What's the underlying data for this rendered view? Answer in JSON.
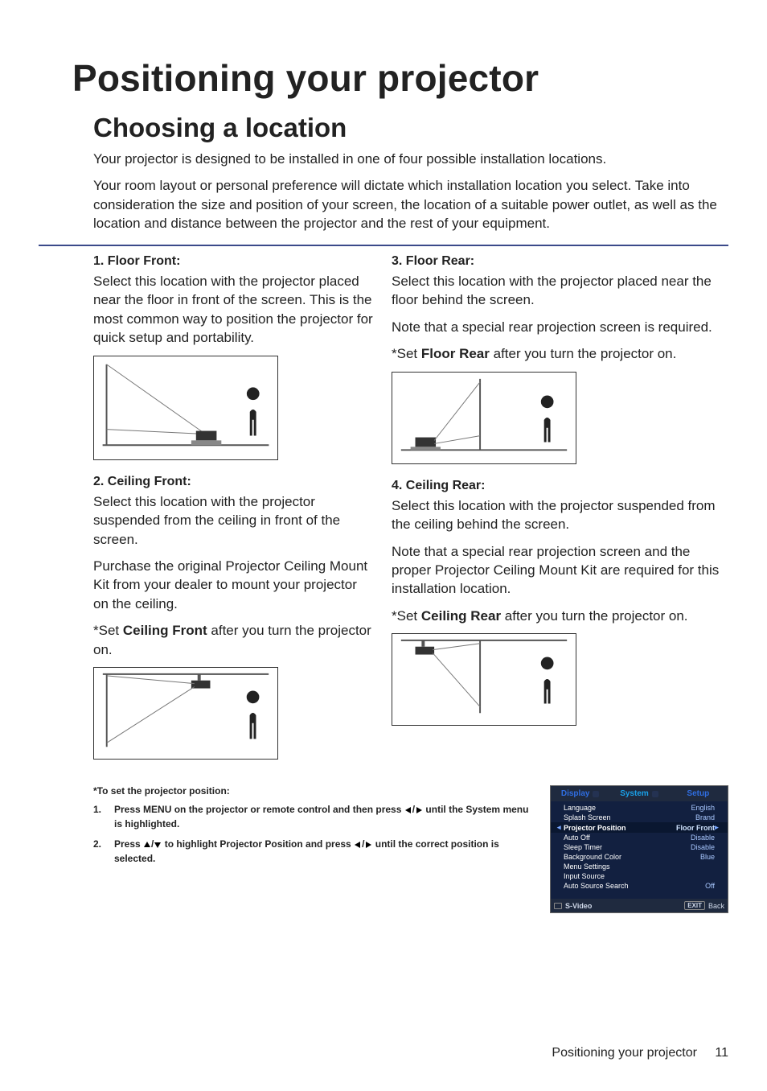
{
  "title": "Positioning your projector",
  "section": "Choosing a location",
  "intro": [
    "Your projector is designed to be installed in one of four possible installation locations.",
    "Your room layout or personal preference will dictate which installation location you select. Take into consideration the size and position of your screen, the location of a suitable power outlet, as well as the location and distance between the projector and the rest of your equipment."
  ],
  "positions": {
    "floor_front": {
      "head": "1.  Floor Front:",
      "p1": "Select this location with the projector placed near the floor in front of the screen. This is the most common way to position the projector for quick setup and portability."
    },
    "ceiling_front": {
      "head": "2.  Ceiling Front:",
      "p1": "Select this location with the projector suspended from the ceiling in front of the screen.",
      "p2": "Purchase the original Projector Ceiling Mount Kit from your dealer to mount your projector on the ceiling.",
      "set_pre": "*Set ",
      "set_bold": "Ceiling Front",
      "set_post": " after you turn the projector on."
    },
    "floor_rear": {
      "head": "3.  Floor Rear:",
      "p1": "Select this location with the projector placed near the floor behind the screen.",
      "p2": "Note that a special rear projection screen is required.",
      "set_pre": "*Set ",
      "set_bold": "Floor Rear",
      "set_post": " after you turn the projector on."
    },
    "ceiling_rear": {
      "head": "4.  Ceiling Rear:",
      "p1": "Select this location with the projector suspended from the ceiling behind the screen.",
      "p2": "Note that a special rear projection screen and the proper Projector Ceiling Mount Kit are required for this installation location.",
      "set_pre": "*Set ",
      "set_bold": "Ceiling Rear",
      "set_post": " after you turn the projector on."
    }
  },
  "foot": {
    "title": "*To set the projector position:",
    "step1_num": "1.",
    "step1_a": "Press MENU on the projector or remote control and then press ",
    "step1_b": "  until the System menu is highlighted.",
    "step2_num": "2.",
    "step2_a": "Press ",
    "step2_b": " to highlight Projector Position and press ",
    "step2_c": "  until the correct position is selected."
  },
  "osd": {
    "tabs": {
      "display": "Display",
      "system": "System",
      "setup": "Setup"
    },
    "rows": [
      {
        "label": "Language",
        "val": "English"
      },
      {
        "label": "Splash Screen",
        "val": "Brand"
      },
      {
        "label": "Projector Position",
        "val": "Floor Front",
        "hi": true
      },
      {
        "label": "Auto Off",
        "val": "Disable"
      },
      {
        "label": "Sleep Timer",
        "val": "Disable"
      },
      {
        "label": "Background Color",
        "val": "Blue"
      },
      {
        "label": "Menu Settings",
        "val": ""
      },
      {
        "label": "Input Source",
        "val": ""
      },
      {
        "label": "Auto Source Search",
        "val": "Off"
      }
    ],
    "footer": {
      "source": "S-Video",
      "exit": "EXIT",
      "back": "Back"
    }
  },
  "page_footer": {
    "text": "Positioning your projector",
    "num": "11"
  }
}
